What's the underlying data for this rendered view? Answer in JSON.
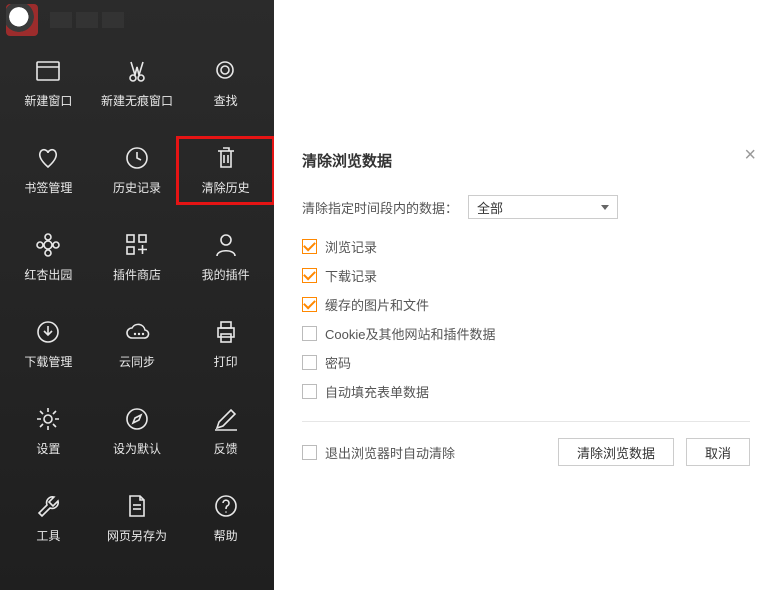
{
  "sidebar": {
    "items": [
      {
        "label": "新建窗口",
        "icon": "window-icon"
      },
      {
        "label": "新建无痕窗口",
        "icon": "incognito-icon"
      },
      {
        "label": "查找",
        "icon": "search-icon"
      },
      {
        "label": "书签管理",
        "icon": "heart-icon"
      },
      {
        "label": "历史记录",
        "icon": "clock-icon"
      },
      {
        "label": "清除历史",
        "icon": "trash-icon",
        "highlight": true
      },
      {
        "label": "红杏出园",
        "icon": "flower-icon"
      },
      {
        "label": "插件商店",
        "icon": "apps-icon"
      },
      {
        "label": "我的插件",
        "icon": "person-icon"
      },
      {
        "label": "下载管理",
        "icon": "download-icon"
      },
      {
        "label": "云同步",
        "icon": "cloud-icon"
      },
      {
        "label": "打印",
        "icon": "print-icon"
      },
      {
        "label": "设置",
        "icon": "gear-icon"
      },
      {
        "label": "设为默认",
        "icon": "compass-icon"
      },
      {
        "label": "反馈",
        "icon": "pencil-icon"
      },
      {
        "label": "工具",
        "icon": "wrench-icon"
      },
      {
        "label": "网页另存为",
        "icon": "file-icon"
      },
      {
        "label": "帮助",
        "icon": "help-icon"
      }
    ]
  },
  "dialog": {
    "title": "清除浏览数据",
    "close_label": "×",
    "range_label": "清除指定时间段内的数据：",
    "range_value": "全部",
    "options": [
      {
        "label": "浏览记录",
        "checked": true
      },
      {
        "label": "下载记录",
        "checked": true
      },
      {
        "label": "缓存的图片和文件",
        "checked": true
      },
      {
        "label": "Cookie及其他网站和插件数据",
        "checked": false
      },
      {
        "label": "密码",
        "checked": false
      },
      {
        "label": "自动填充表单数据",
        "checked": false
      }
    ],
    "auto_clear": {
      "label": "退出浏览器时自动清除",
      "checked": false
    },
    "confirm_label": "清除浏览数据",
    "cancel_label": "取消"
  }
}
